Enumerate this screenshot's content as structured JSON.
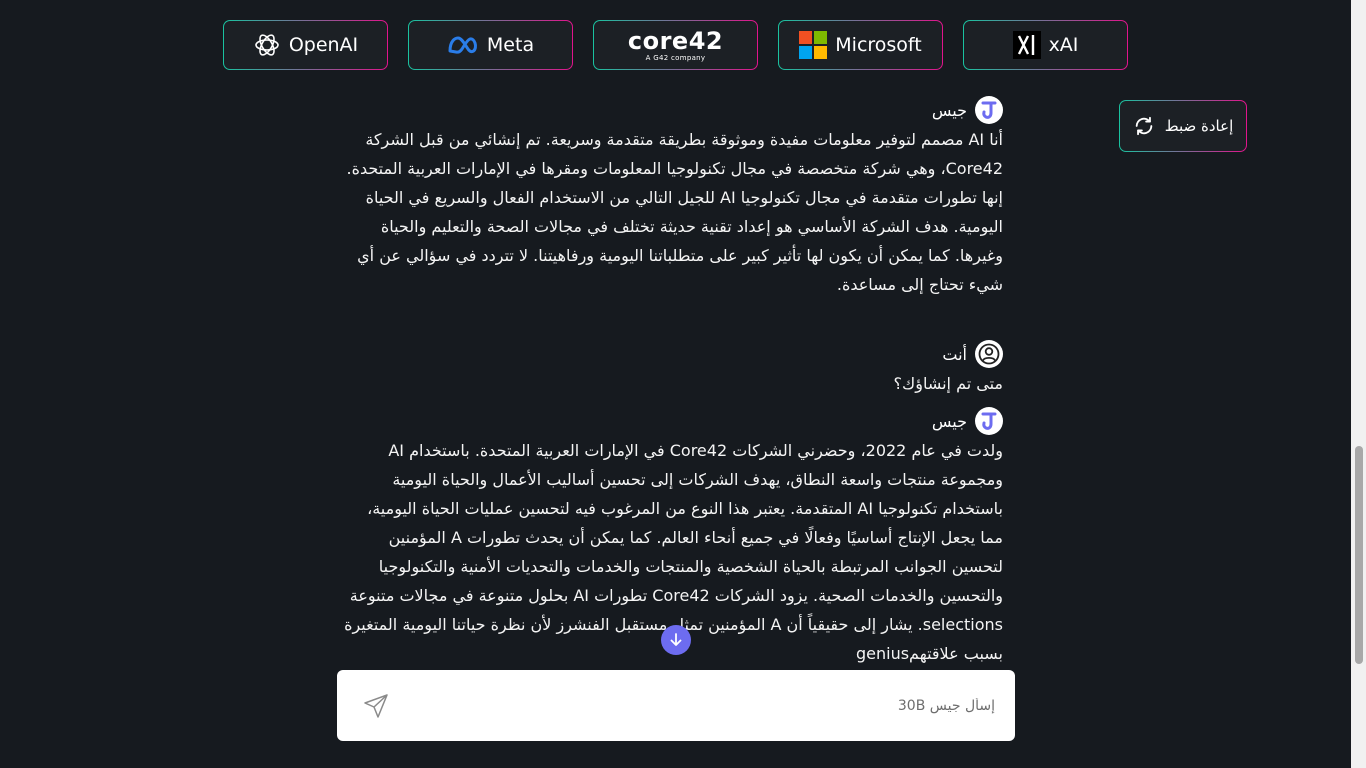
{
  "providers": [
    {
      "label": "OpenAI",
      "icon": "openai-icon"
    },
    {
      "label": "Meta",
      "icon": "meta-icon"
    },
    {
      "label": "core42",
      "sublabel": "A G42 company",
      "icon": "core42-logo"
    },
    {
      "label": "Microsoft",
      "icon": "microsoft-icon"
    },
    {
      "label": "xAI",
      "icon": "xai-icon"
    }
  ],
  "reset_label": "إعادة ضبط",
  "messages": [
    {
      "sender": "جيس",
      "text": "أنا AI مصمم لتوفير معلومات مفيدة وموثوقة بطريقة متقدمة وسريعة. تم إنشائي من قبل الشركة Core42، وهي شركة متخصصة في مجال تكنولوجيا المعلومات ومقرها في الإمارات العربية المتحدة. إنها تطورات متقدمة في مجال تكنولوجيا AI للجيل التالي من الاستخدام الفعال والسريع في الحياة اليومية. هدف الشركة الأساسي هو إعداد تقنية حديثة تختلف في مجالات الصحة والتعليم والحياة وغيرها. كما يمكن أن يكون لها تأثير كبير على متطلباتنا اليومية ورفاهيتنا. لا تتردد في سؤالي عن أي شيء تحتاج إلى مساعدة."
    },
    {
      "sender": "أنت",
      "text": "متى تم إنشاؤك؟"
    },
    {
      "sender": "جيس",
      "text": "ولدت في عام 2022، وحضرني الشركات Core42 في الإمارات العربية المتحدة. باستخدام AI ومجموعة منتجات واسعة النطاق، يهدف الشركات إلى تحسين أساليب الأعمال والحياة اليومية باستخدام تكنولوجيا AI المتقدمة. يعتبر هذا النوع من المرغوب فيه لتحسين عمليات الحياة اليومية، مما يجعل الإنتاج أساسيًا وفعالًا في جميع أنحاء العالم. كما يمكن أن يحدث تطورات A المؤمنين لتحسين الجوانب المرتبطة بالحياة الشخصية والمنتجات والخدمات والتحديات الأمنية والتكنولوجيا والتحسين والخدمات الصحية. يزود الشركات Core42 تطورات AI بحلول متنوعة في مجالات متنوعة selections. يشار إلى حقيقياً أن A المؤمنين تمثل مستقبل الفنشرز لأن نظرة حياتنا اليومية المتغيرة بسبب علاقتهمgenius"
    }
  ],
  "composer": {
    "placeholder": "إسأل جيس 30B"
  },
  "colors": {
    "background": "#161a1f",
    "accent_teal": "#19c3a0",
    "accent_pink": "#e0148c",
    "scroll_button": "#6d6cf0",
    "bot_avatar": "#6d6cf0"
  }
}
